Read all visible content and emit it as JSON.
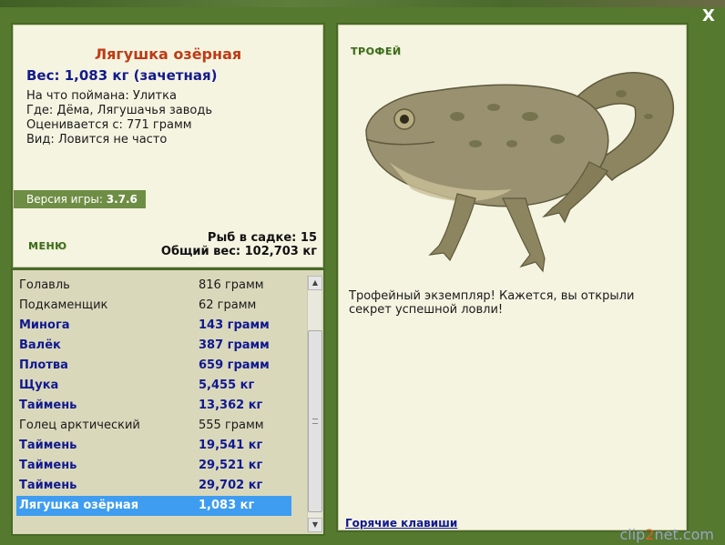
{
  "window": {
    "close_label": "X"
  },
  "catch": {
    "title": "Лягушка озёрная",
    "weight_line": "Вес: 1,083 кг (зачетная)",
    "info": [
      "На что поймана: Улитка",
      "Где: Дёма, Лягушачья заводь",
      "Оценивается с: 771 грамм",
      "Вид: Ловится не часто"
    ]
  },
  "version": {
    "label": "Версия игры: ",
    "value": "3.7.6"
  },
  "menu": {
    "label": "МЕНЮ"
  },
  "stats": {
    "fish_count": "Рыб в садке: 15",
    "total_weight": "Общий вес: 102,703 кг"
  },
  "fish_list": [
    {
      "name": "Голавль",
      "weight": "816 грамм",
      "trophy": false
    },
    {
      "name": "Подкаменщик",
      "weight": "62 грамм",
      "trophy": false
    },
    {
      "name": "Минога",
      "weight": "143 грамм",
      "trophy": true
    },
    {
      "name": "Валёк",
      "weight": "387 грамм",
      "trophy": true
    },
    {
      "name": "Плотва",
      "weight": "659 грамм",
      "trophy": true
    },
    {
      "name": "Щука",
      "weight": "5,455 кг",
      "trophy": true
    },
    {
      "name": "Таймень",
      "weight": "13,362 кг",
      "trophy": true
    },
    {
      "name": "Голец арктический",
      "weight": "555 грамм",
      "trophy": false
    },
    {
      "name": "Таймень",
      "weight": "19,541 кг",
      "trophy": true
    },
    {
      "name": "Таймень",
      "weight": "29,521 кг",
      "trophy": true
    },
    {
      "name": "Таймень",
      "weight": "29,702 кг",
      "trophy": true
    },
    {
      "name": "Лягушка озёрная",
      "weight": "1,083 кг",
      "trophy": true,
      "selected": true
    }
  ],
  "trophy_panel": {
    "label": "ТРОФЕЙ",
    "description": "Трофейный экземпляр! Кажется, вы открыли секрет успешной ловли!",
    "hotkeys": "Горячие клавиши"
  },
  "watermark": {
    "pre": "clip",
    "accent": "2",
    "post": "net.com"
  },
  "colors": {
    "frame": "#55792f",
    "panel": "#f5f4e1",
    "title": "#bf3b14",
    "trophy_text": "#101990",
    "selection": "#3e9df0"
  }
}
